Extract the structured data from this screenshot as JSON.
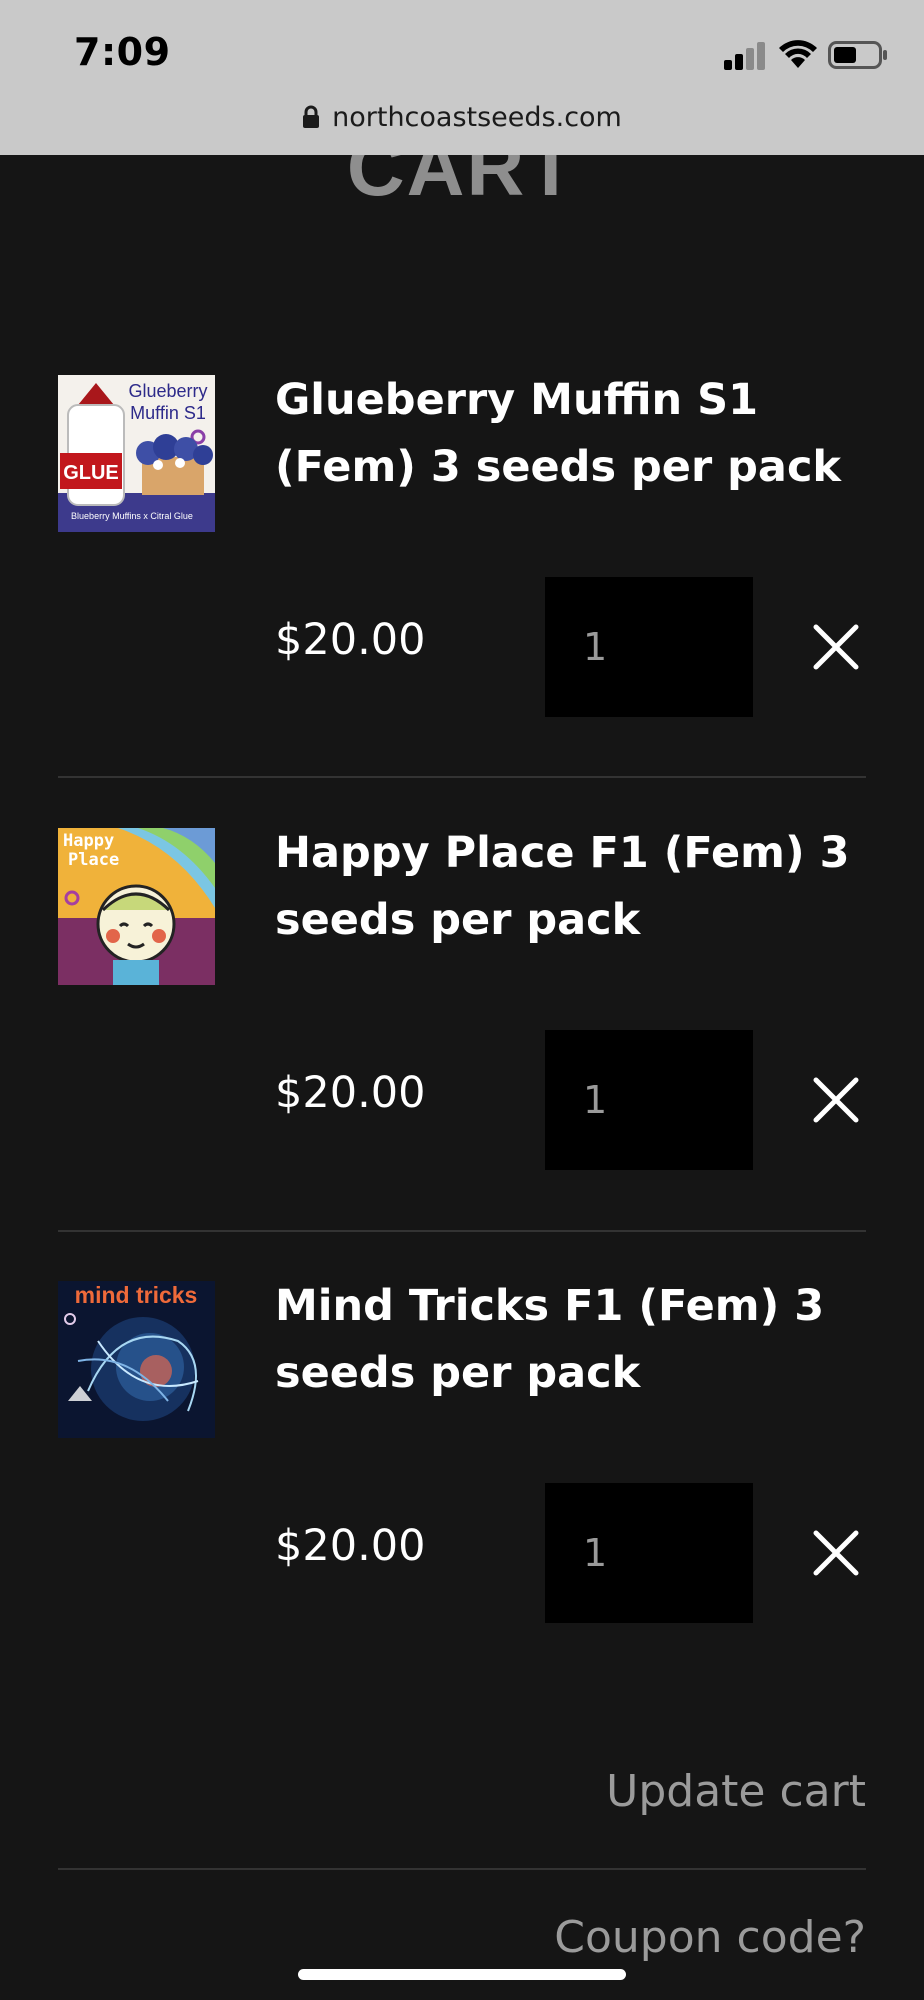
{
  "status_bar": {
    "time": "7:09",
    "signal_icon": "cellular-signal-icon",
    "wifi_icon": "wifi-icon",
    "battery_icon": "battery-icon"
  },
  "browser": {
    "url": "northcoastseeds.com",
    "lock_icon": "lock-icon"
  },
  "page": {
    "title": "CART"
  },
  "cart": {
    "items": [
      {
        "name": "Glueberry Muffin S1 (Fem) 3 seeds per pack",
        "price": "$20.00",
        "quantity": "1",
        "image_text": [
          "Glueberry",
          "Muffin S1",
          "GLUE",
          "Blueberry Muffins x Citral Glue"
        ],
        "remove_icon": "close-icon"
      },
      {
        "name": "Happy Place F1 (Fem) 3 seeds per pack",
        "price": "$20.00",
        "quantity": "1",
        "image_text": [
          "Happy",
          "Place"
        ],
        "remove_icon": "close-icon"
      },
      {
        "name": "Mind Tricks F1 (Fem) 3 seeds per pack",
        "price": "$20.00",
        "quantity": "1",
        "image_text": [
          "mind tricks"
        ],
        "remove_icon": "close-icon"
      }
    ],
    "update_label": "Update cart",
    "coupon_label": "Coupon code?"
  },
  "colors": {
    "background": "#151515",
    "text": "#ffffff",
    "muted_text": "#9b9b9b",
    "input_bg": "#000000",
    "chrome_bg": "#c9c9c9"
  }
}
